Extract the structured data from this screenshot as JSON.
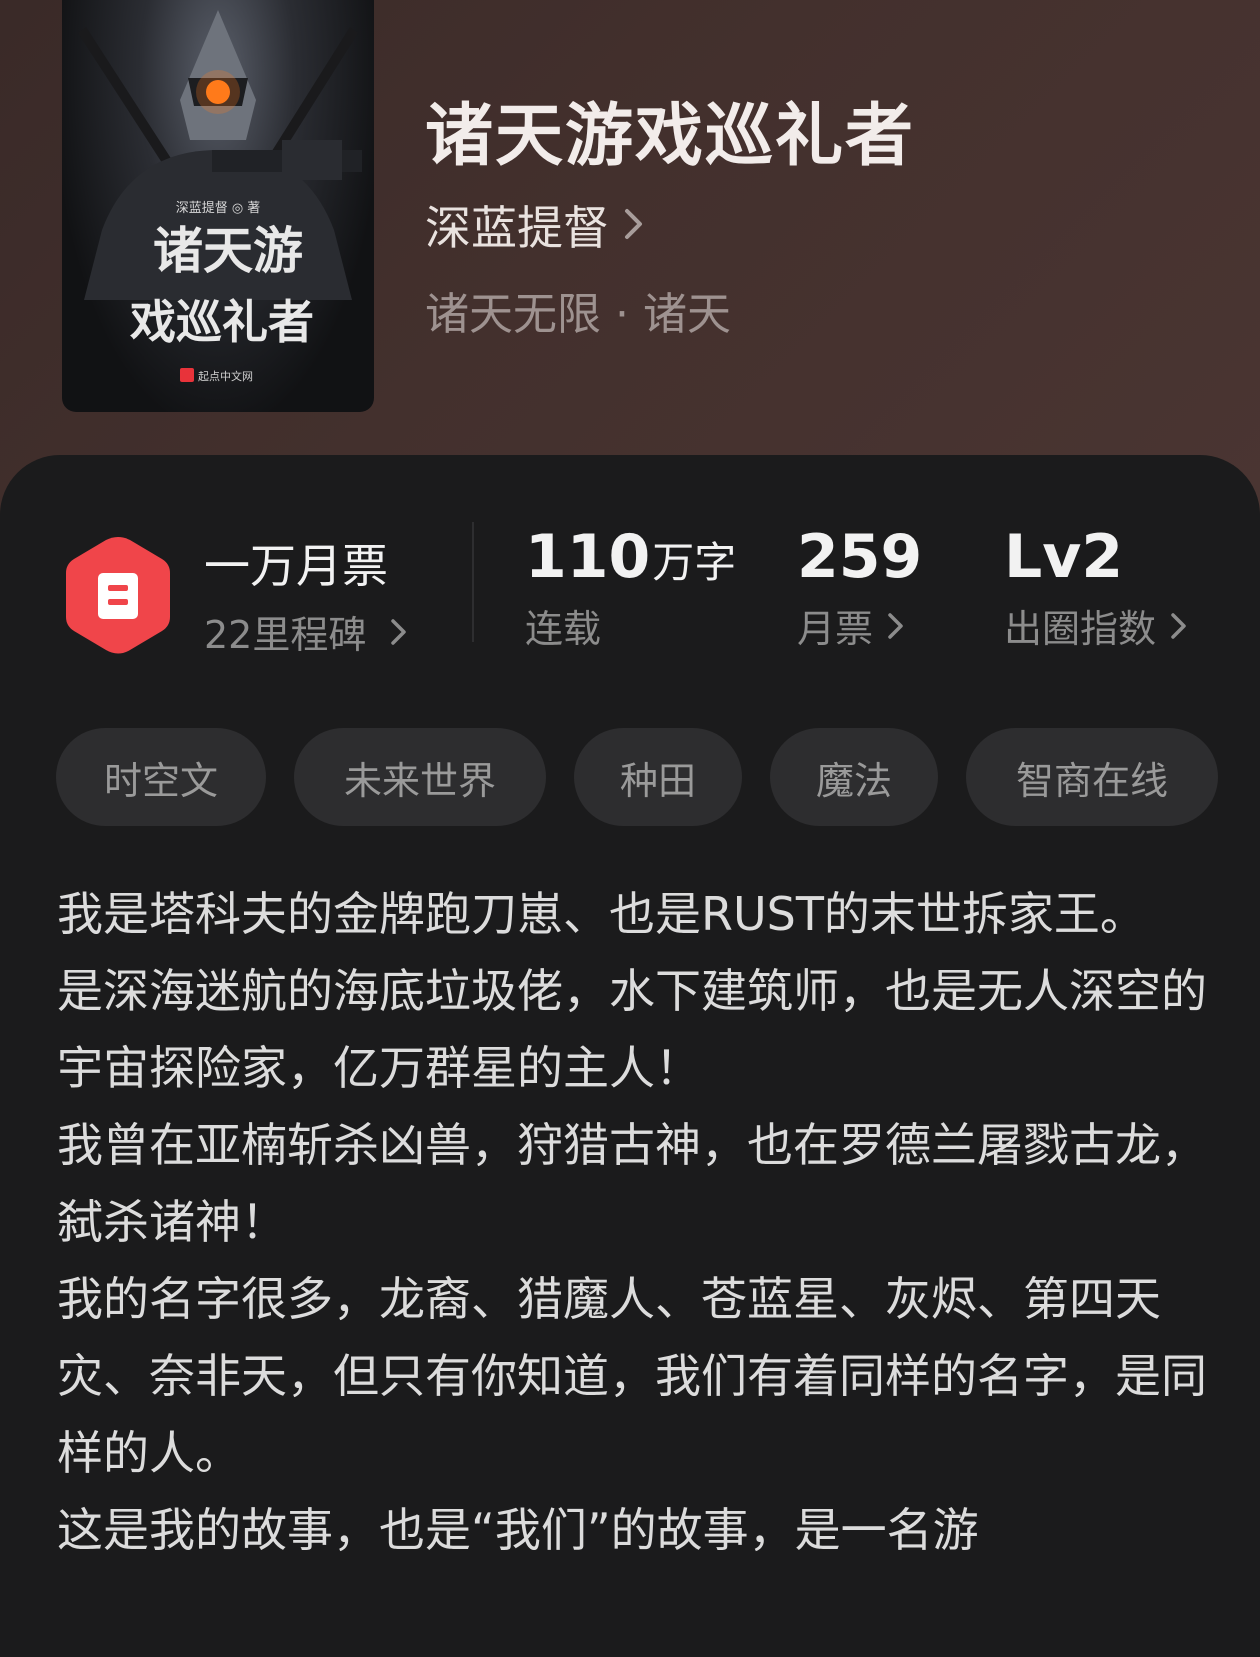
{
  "book": {
    "title": "诸天游戏巡礼者",
    "author": "深蓝提督",
    "category": "诸天无限 · 诸天",
    "cover": {
      "author_line": "深蓝提督 ◎ 著",
      "title_line1": "诸天游",
      "title_line2": "戏巡礼者",
      "publisher": "起点中文网"
    }
  },
  "stats": {
    "ticket": {
      "title": "一万月票",
      "sub": "22里程碑"
    },
    "words": {
      "number": "110",
      "unit": "万字",
      "label": "连载"
    },
    "monthly": {
      "number": "259",
      "label": "月票"
    },
    "level": {
      "number": "Lv2",
      "label": "出圈指数"
    }
  },
  "tags": [
    "时空文",
    "未来世界",
    "种田",
    "魔法",
    "智商在线"
  ],
  "description": [
    "我是塔科夫的金牌跑刀崽、也是RUST的末世拆家王。",
    "是深海迷航的海底垃圾佬，水下建筑师，也是无人深空的宇宙探险家，亿万群星的主人！",
    "我曾在亚楠斩杀凶兽，狩猎古神，也在罗德兰屠戮古龙，弑杀诸神！",
    "我的名字很多，龙裔、猎魔人、苍蓝星、灰烬、第四天灾、奈非天，但只有你知道，我们有着同样的名字，是同样的人。",
    "这是我的故事，也是“我们”的故事，是一名游"
  ],
  "colors": {
    "background": "#1b1b1c",
    "hero": "#43302d",
    "tag_bg": "#2d2d2f",
    "badge_red": "#f0454a"
  },
  "icons": {
    "author_chevron": "chevron-right-icon",
    "ticket_badge": "ticket-hexagon-icon"
  }
}
